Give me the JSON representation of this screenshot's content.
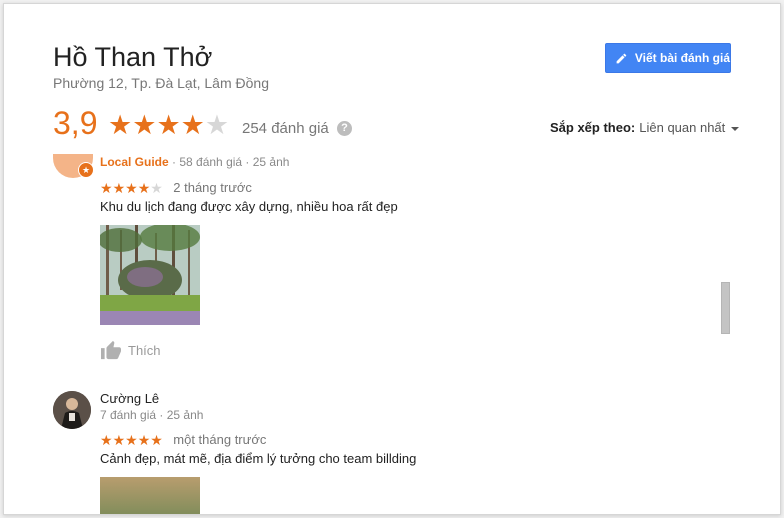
{
  "place": {
    "name": "Hồ Than Thở",
    "address": "Phường 12, Tp. Đà Lạt, Lâm Đồng"
  },
  "actions": {
    "write_review_label": "Viết bài đánh giá"
  },
  "summary": {
    "rating": "3,9",
    "stars": 4,
    "total_stars": 5,
    "review_count": "254 đánh giá",
    "help_glyph": "?"
  },
  "sort": {
    "label": "Sắp xếp theo:",
    "value": "Liên quan nhất"
  },
  "reviews": [
    {
      "author_badge": "Local Guide",
      "meta": " · 58 đánh giá · 25 ảnh",
      "stars": 4,
      "time": "2 tháng trước",
      "text": "Khu du lịch đang được xây dựng, nhiều hoa rất đẹp",
      "like_label": "Thích"
    },
    {
      "author": "Cường Lê",
      "meta": "7 đánh giá · 25 ảnh",
      "stars": 5,
      "time": "một tháng trước",
      "text": "Cảnh đẹp, mát mẽ, địa điểm lý tưởng cho team billding"
    }
  ],
  "colors": {
    "accent": "#e7711b",
    "button": "#4285f4",
    "star_off": "#d7d7d7"
  },
  "icons": [
    "pencil-icon",
    "help-icon",
    "dropdown-caret-icon",
    "star-icon",
    "thumbs-up-icon",
    "local-guide-badge-icon"
  ]
}
